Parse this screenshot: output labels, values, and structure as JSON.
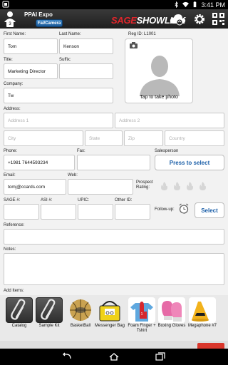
{
  "statusbar": {
    "time": "3:41 PM"
  },
  "header": {
    "event_title": "PPAI Expo",
    "mode_button": "Fal/Camera",
    "brand_part1": "SAGE",
    "brand_part2": "SHOWLINK",
    "user_badge": "3"
  },
  "form": {
    "first_name": {
      "label": "First Name:",
      "value": "Tom"
    },
    "last_name": {
      "label": "Last Name:",
      "value": "Kenson"
    },
    "reg_id": {
      "label": "Reg ID:",
      "value": "L1001"
    },
    "title": {
      "label": "Title:",
      "value": "Marketing Director"
    },
    "suffix": {
      "label": "Suffix:",
      "value": ""
    },
    "company": {
      "label": "Company:",
      "value": "Tw"
    },
    "photo_label": "Tap to take photo",
    "address": {
      "label": "Address:",
      "address1_placeholder": "Address 1",
      "address2_placeholder": "Address 2",
      "city_placeholder": "City",
      "state_placeholder": "State",
      "zip_placeholder": "Zip",
      "country_placeholder": "Country"
    },
    "phone": {
      "label": "Phone:",
      "value": "+1981 7644593234"
    },
    "fax": {
      "label": "Fax:",
      "value": ""
    },
    "salesperson": {
      "label": "Salesperson",
      "button": "Press to select"
    },
    "email": {
      "label": "Email:",
      "value": "tomj@ccards.com"
    },
    "web": {
      "label": "Web:",
      "value": ""
    },
    "prospect_rating": {
      "label_line1": "Prospect",
      "label_line2": "Rating:",
      "rating": 0,
      "max": 4
    },
    "sage_no": {
      "label": "SAGE #:",
      "value": ""
    },
    "asi_no": {
      "label": "ASI #:",
      "value": ""
    },
    "upic": {
      "label": "UPIC:",
      "value": ""
    },
    "other_id": {
      "label": "Other ID:",
      "value": ""
    },
    "follow_up": {
      "label": "Follow-up:",
      "button": "Select"
    },
    "reference": {
      "label": "Reference:",
      "value": ""
    },
    "notes": {
      "label": "Notes:",
      "value": ""
    },
    "add_items": {
      "label": "Add Items:"
    }
  },
  "items": [
    {
      "label": "Catalog",
      "icon": "paperclip-icon"
    },
    {
      "label": "Sample Kit",
      "icon": "paperclip-icon"
    },
    {
      "label": "BasketBall",
      "icon": "basketball-image"
    },
    {
      "label": "Messenger Bag",
      "icon": "bag-image"
    },
    {
      "label": "Foam Finger + Tshirt",
      "icon": "foam-finger-image"
    },
    {
      "label": "Boxing Gloves",
      "icon": "boxing-gloves-image"
    },
    {
      "label": "Megaphone #7",
      "icon": "megaphone-image"
    }
  ],
  "colors": {
    "accent": "#1b5fa8",
    "brand_red": "#e2252b",
    "header_bg": "#2a2a2a"
  }
}
